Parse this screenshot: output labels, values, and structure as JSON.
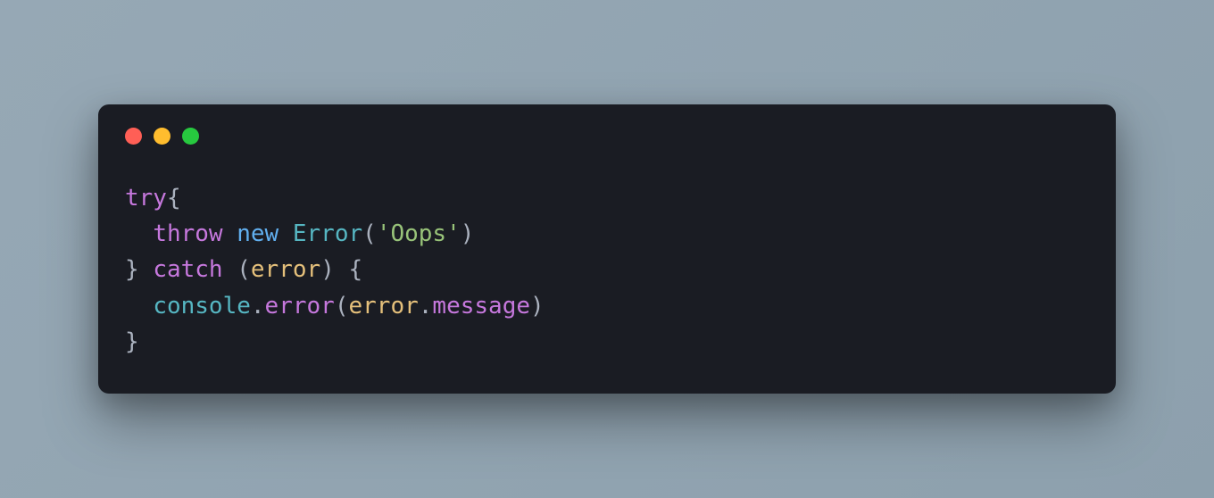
{
  "window": {
    "dots": [
      "red",
      "yellow",
      "green"
    ]
  },
  "code": {
    "line1": {
      "try": "try",
      "brace_open": "{"
    },
    "line2": {
      "indent": "  ",
      "throw": "throw",
      "new": "new",
      "error_class": "Error",
      "paren_open": "(",
      "string": "'Oops'",
      "paren_close": ")"
    },
    "line3": {
      "brace_close": "}",
      "catch": "catch",
      "paren_open": "(",
      "param": "error",
      "paren_close": ")",
      "brace_open": "{"
    },
    "line4": {
      "indent": "  ",
      "console": "console",
      "dot1": ".",
      "method": "error",
      "paren_open": "(",
      "arg": "error",
      "dot2": ".",
      "prop": "message",
      "paren_close": ")"
    },
    "line5": {
      "brace_close": "}"
    }
  }
}
